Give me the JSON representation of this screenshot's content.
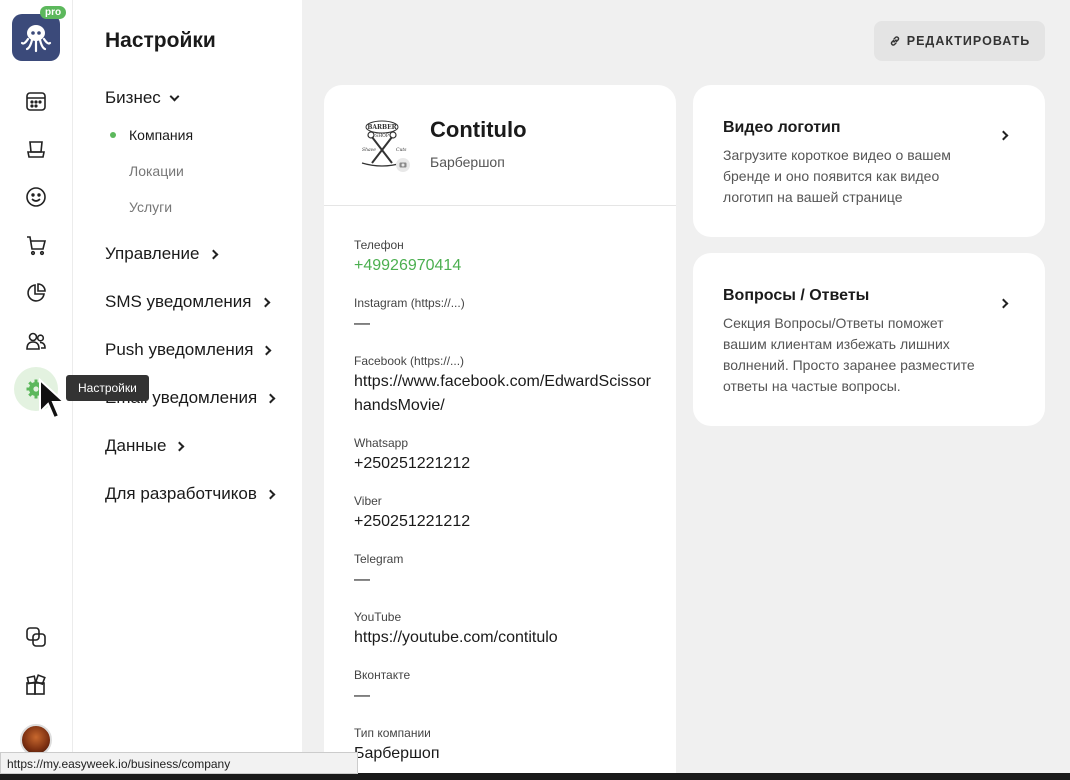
{
  "rail": {
    "pro_badge": "pro",
    "icons": [
      "calendar-icon",
      "bookings-icon",
      "clients-icon",
      "cart-icon",
      "analytics-icon",
      "staff-icon",
      "settings-icon",
      "integrations-icon",
      "apps-icon"
    ],
    "accent": "#5cb85c"
  },
  "tooltip": "Настройки",
  "nav": {
    "title": "Настройки",
    "business": "Бизнес",
    "sub": [
      "Компания",
      "Локации",
      "Услуги"
    ],
    "items": [
      "Управление",
      "SMS уведомления",
      "Push уведомления",
      "Email уведомления",
      "Данные",
      "Для разработчиков"
    ]
  },
  "edit_button": "РЕДАКТИРОВАТЬ",
  "company": {
    "name": "Contitulo",
    "type": "Барбершоп",
    "logo_text": [
      "BARBER",
      "SHOP",
      "Shave",
      "Cuts"
    ],
    "fields": [
      {
        "label": "Телефон",
        "value": "+49926970414"
      },
      {
        "label": "Instagram (https://...)",
        "value": "—"
      },
      {
        "label": "Facebook (https://...)",
        "value": "https://www.facebook.com/EdwardScissorhandsMovie/"
      },
      {
        "label": "Whatsapp",
        "value": "+250251221212"
      },
      {
        "label": "Viber",
        "value": "+250251221212"
      },
      {
        "label": "Telegram",
        "value": "—"
      },
      {
        "label": "YouTube",
        "value": "https://youtube.com/contitulo"
      },
      {
        "label": "Вконтакте",
        "value": "—"
      },
      {
        "label": "Тип компании",
        "value": "Барбершоп"
      }
    ]
  },
  "video_logo": {
    "title": "Видео логотип",
    "desc": "Загрузите короткое видео о вашем бренде и оно появится как видео логотип на вашей странице"
  },
  "faq": {
    "title": "Вопросы / Ответы",
    "desc": "Секция Вопросы/Ответы поможет вашим клиентам избежать лишних волнений. Просто заранее разместите ответы на частые вопросы."
  },
  "status_url": "https://my.easyweek.io/business/company"
}
